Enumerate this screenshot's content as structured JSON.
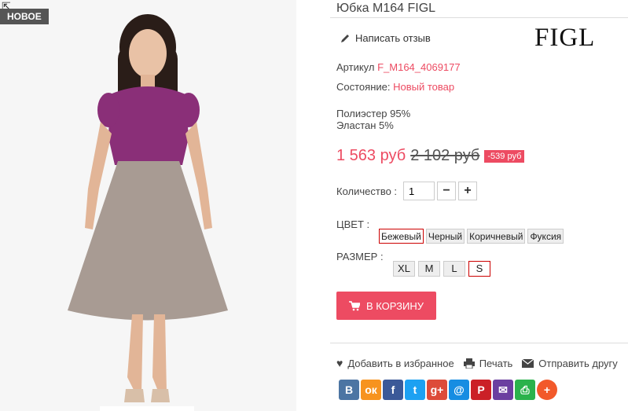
{
  "badge": {
    "new": "НОВОЕ"
  },
  "product": {
    "title": "Юбка M164 FIGL",
    "review_link": "Написать отзыв",
    "brand": "FIGL",
    "sku_label": "Артикул",
    "sku_value": "F_M164_4069177",
    "condition_label": "Состояние:",
    "condition_value": "Новый товар",
    "composition_1": "Полиэстер 95%",
    "composition_2": "Эластан 5%",
    "price": "1 563 руб",
    "old_price": "2 102 руб",
    "discount": "-539 руб"
  },
  "quantity": {
    "label": "Количество :",
    "value": "1",
    "minus": "−",
    "plus": "+"
  },
  "color": {
    "label": "ЦВЕТ :",
    "options": [
      "Бежевый",
      "Черный",
      "Коричневый",
      "Фуксия"
    ],
    "selected": "Бежевый"
  },
  "size": {
    "label": "РАЗМЕР :",
    "options": [
      "XL",
      "M",
      "L",
      "S"
    ],
    "selected": "S"
  },
  "cart_button": "В КОРЗИНУ",
  "actions": {
    "favorite": "Добавить в избранное",
    "print": "Печать",
    "send": "Отправить другу"
  },
  "social": [
    {
      "name": "vk-icon",
      "glyph": "В",
      "color": "#4c75a3"
    },
    {
      "name": "odnoklassniki-icon",
      "glyph": "ок",
      "color": "#f7931e"
    },
    {
      "name": "facebook-icon",
      "glyph": "f",
      "color": "#3b5998"
    },
    {
      "name": "twitter-icon",
      "glyph": "t",
      "color": "#1da1f2"
    },
    {
      "name": "google-plus-icon",
      "glyph": "g+",
      "color": "#dd4b39"
    },
    {
      "name": "mail-ru-icon",
      "glyph": "@",
      "color": "#168de2"
    },
    {
      "name": "pinterest-icon",
      "glyph": "P",
      "color": "#cb2027"
    },
    {
      "name": "email-icon",
      "glyph": "✉",
      "color": "#6b3fa0"
    },
    {
      "name": "print-icon",
      "glyph": "⎙",
      "color": "#2bb24c"
    },
    {
      "name": "more-icon",
      "glyph": "+",
      "color": "#f2592a"
    }
  ],
  "colors": {
    "accent": "#ed4b62",
    "selected_border": "#cc0000"
  }
}
